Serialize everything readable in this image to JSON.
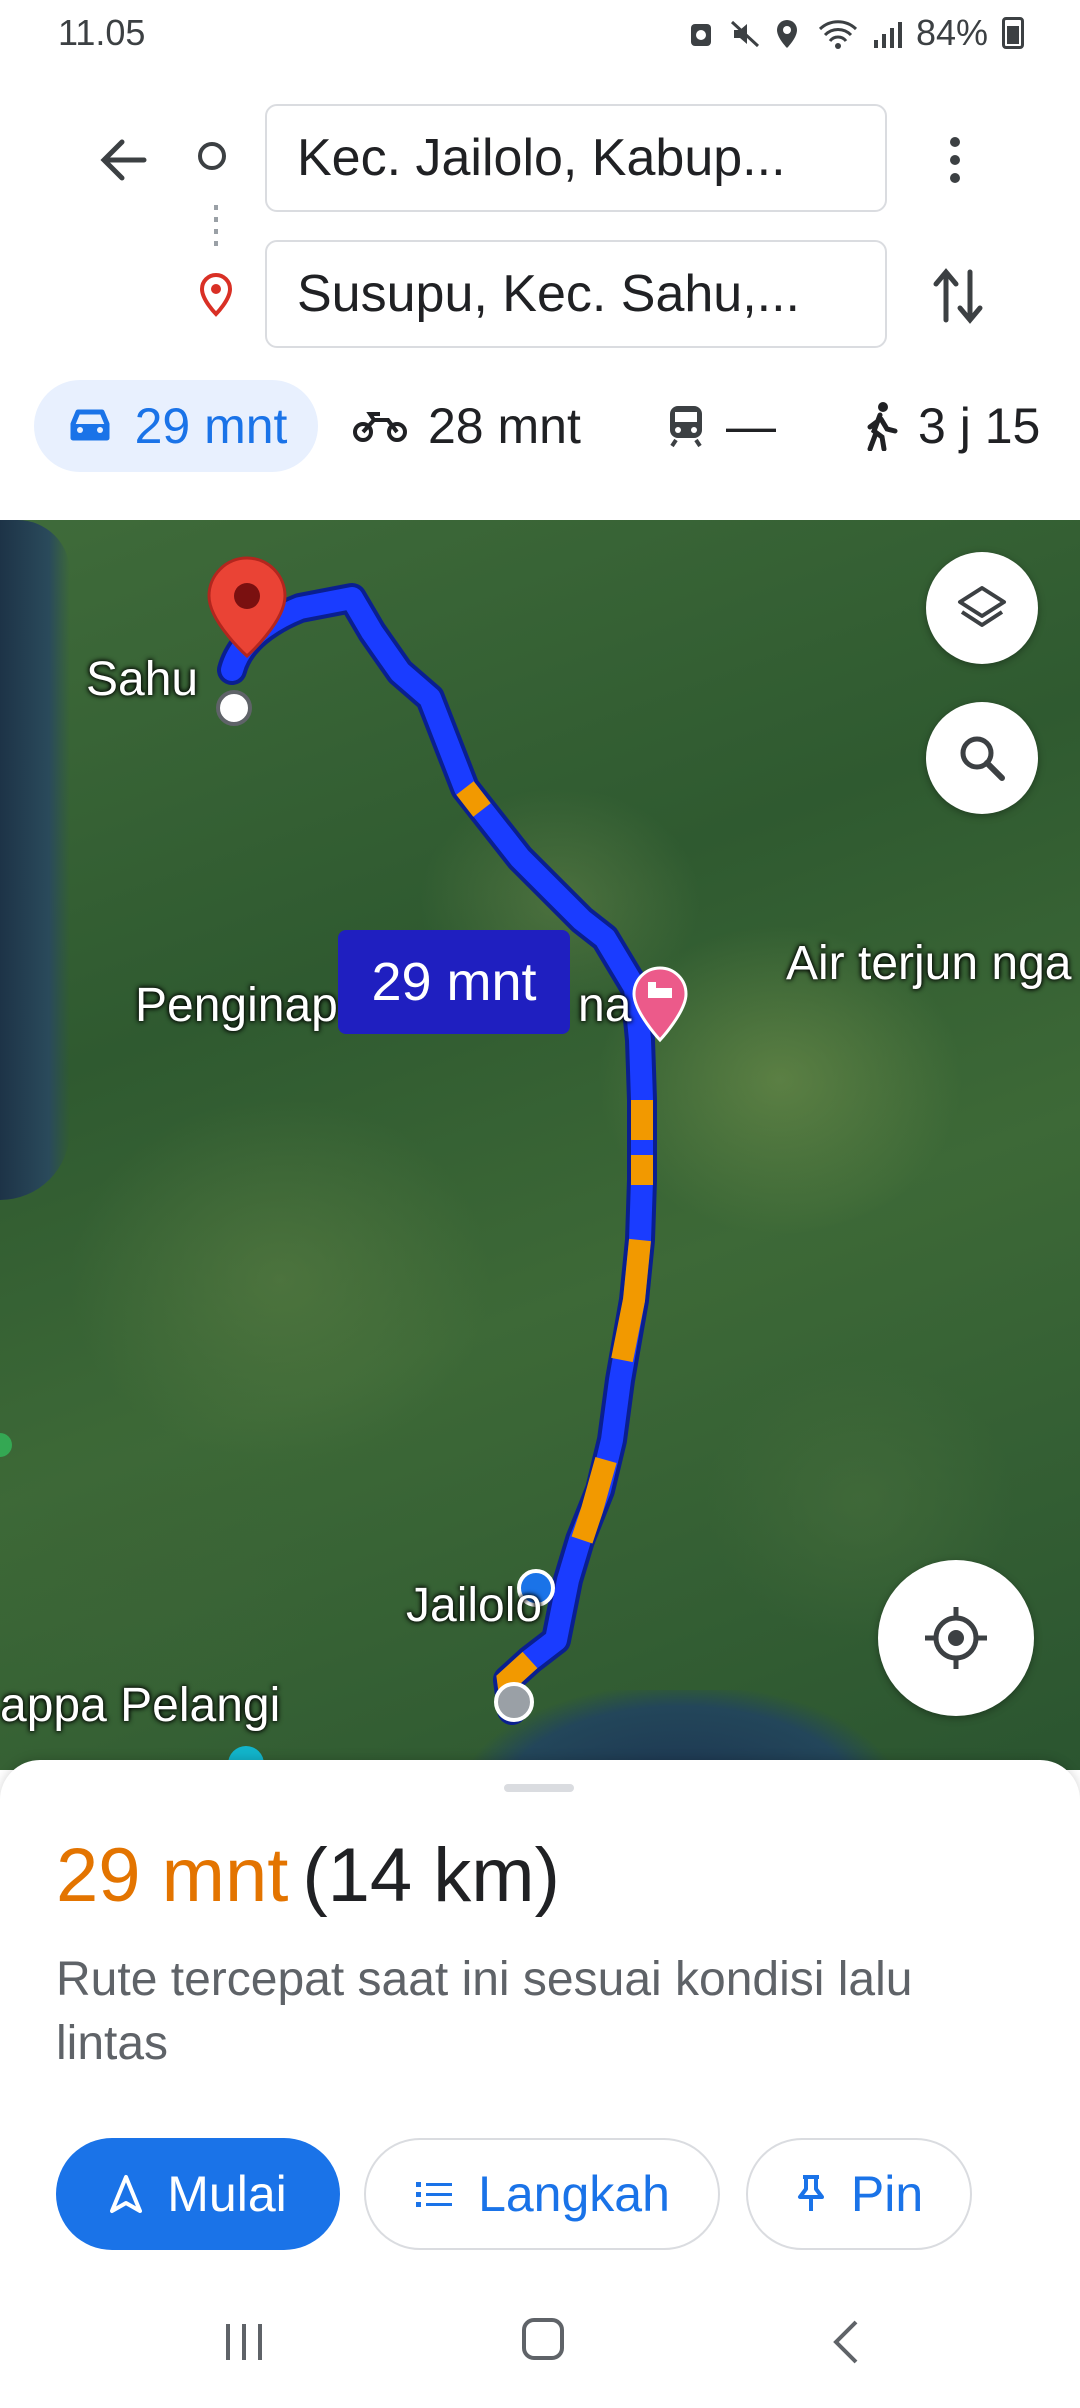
{
  "status_bar": {
    "time": "11.05",
    "battery": "84%"
  },
  "directions": {
    "origin": "Kec. Jailolo, Kabup...",
    "destination": "Susupu, Kec. Sahu,..."
  },
  "modes": {
    "car": "29 mnt",
    "motorcycle": "28 mnt",
    "transit": "—",
    "walk": "3 j 15"
  },
  "map": {
    "labels": {
      "sahu": "Sahu",
      "penginapan": "Penginap",
      "penginapan_tail": "na",
      "air_terjun": "Air terjun nga",
      "jailolo": "Jailolo",
      "pelangi": "appa Pelangi"
    },
    "route_badge": "29 mnt"
  },
  "sheet": {
    "duration": "29 mnt",
    "distance": "(14 km)",
    "description": "Rute tercepat saat ini sesuai kondisi lalu lintas",
    "start_label": "Mulai",
    "steps_label": "Langkah",
    "pin_label": "Pin"
  },
  "colors": {
    "accent": "#1a73e8",
    "route_blue": "#1a3cff",
    "traffic_orange": "#f29900",
    "duration_orange": "#e37400",
    "pin_red": "#d93025"
  }
}
